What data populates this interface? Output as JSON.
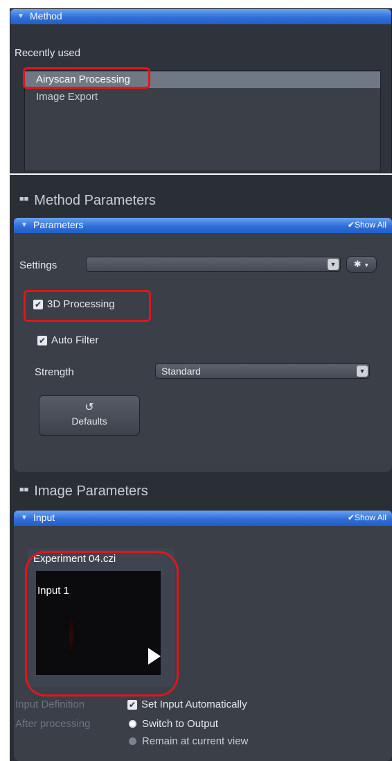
{
  "method": {
    "header": "Method",
    "recently_used_label": "Recently used",
    "items": [
      "Airyscan Processing",
      "Image Export"
    ]
  },
  "method_parameters": {
    "section_title": "Method Parameters",
    "header": "Parameters",
    "show_all": "Show All",
    "settings_label": "Settings",
    "settings_value": "",
    "processing_3d_label": "3D Processing",
    "processing_3d_checked": true,
    "auto_filter_label": "Auto Filter",
    "auto_filter_checked": true,
    "strength_label": "Strength",
    "strength_value": "Standard",
    "defaults_label": "Defaults"
  },
  "image_parameters": {
    "section_title": "Image Parameters",
    "header": "Input",
    "show_all": "Show All",
    "file_name": "Experiment 04.czi",
    "input_name": "Input 1",
    "input_definition_label": "Input Definition",
    "set_input_auto_label": "Set Input Automatically",
    "after_processing_label": "After processing",
    "switch_to_output_label": "Switch to Output",
    "remain_label": "Remain at current view"
  },
  "icons": {
    "collapse": "triangle-down-icon",
    "grip": "grip-icon",
    "check": "check-icon",
    "gear": "gear-icon",
    "reset": "undo-icon",
    "play": "play-icon"
  },
  "colors": {
    "accent": "#2f6fd9",
    "highlight": "#e0161b"
  }
}
